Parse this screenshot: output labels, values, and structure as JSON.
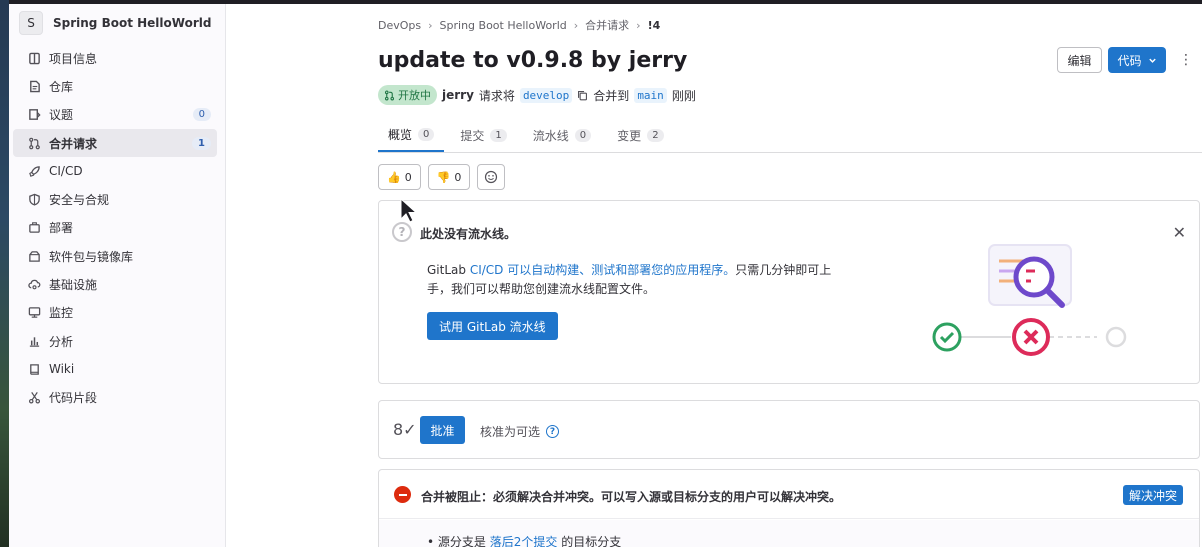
{
  "sidebar": {
    "avatar_letter": "S",
    "project_name": "Spring Boot HelloWorld",
    "items": [
      {
        "label": "项目信息",
        "icon": "project-info-icon",
        "count": ""
      },
      {
        "label": "仓库",
        "icon": "repository-icon",
        "count": ""
      },
      {
        "label": "议题",
        "icon": "issues-icon",
        "count": "0"
      },
      {
        "label": "合并请求",
        "icon": "merge-request-icon",
        "count": "1",
        "active": true
      },
      {
        "label": "CI/CD",
        "icon": "rocket-icon",
        "count": ""
      },
      {
        "label": "安全与合规",
        "icon": "shield-icon",
        "count": ""
      },
      {
        "label": "部署",
        "icon": "deploy-icon",
        "count": ""
      },
      {
        "label": "软件包与镜像库",
        "icon": "package-icon",
        "count": ""
      },
      {
        "label": "基础设施",
        "icon": "cloud-gear-icon",
        "count": ""
      },
      {
        "label": "监控",
        "icon": "monitor-icon",
        "count": ""
      },
      {
        "label": "分析",
        "icon": "chart-icon",
        "count": ""
      },
      {
        "label": "Wiki",
        "icon": "book-icon",
        "count": ""
      },
      {
        "label": "代码片段",
        "icon": "scissors-icon",
        "count": ""
      }
    ]
  },
  "breadcrumb": [
    "DevOps",
    "Spring Boot HelloWorld",
    "合并请求",
    "!4"
  ],
  "mr": {
    "title": "update to v0.9.8 by jerry",
    "status": "开放中",
    "author": "jerry",
    "request_text": "请求将",
    "source_branch": "develop",
    "merge_to_text": "合并到",
    "target_branch": "main",
    "time": "刚刚"
  },
  "header_buttons": {
    "edit": "编辑",
    "code": "代码"
  },
  "tabs": [
    {
      "label": "概览",
      "count": "0",
      "active": true
    },
    {
      "label": "提交",
      "count": "1"
    },
    {
      "label": "流水线",
      "count": "0"
    },
    {
      "label": "变更",
      "count": "2"
    }
  ],
  "reactions": {
    "thumbs_up": "0",
    "thumbs_down": "0"
  },
  "pipeline_card": {
    "title": "此处没有流水线。",
    "desc_prefix": "GitLab ",
    "desc_link": "CI/CD 可以自动构建、测试和部署您的应用程序。",
    "desc_suffix": "只需几分钟即可上手，我们可以帮助您创建流水线配置文件。",
    "button": "试用 GitLab 流水线"
  },
  "approval": {
    "button": "批准",
    "text": "核准为可选"
  },
  "merge_block": {
    "text": "合并被阻止：必须解决合并冲突。可以写入源或目标分支的用户可以解决冲突。",
    "button": "解决冲突",
    "item_prefix": "源分支是",
    "item_link": "落后2个提交",
    "item_suffix": "的目标分支"
  },
  "colors": {
    "accent": "#1f75cb",
    "success": "#217645",
    "danger": "#dd2b0e"
  }
}
